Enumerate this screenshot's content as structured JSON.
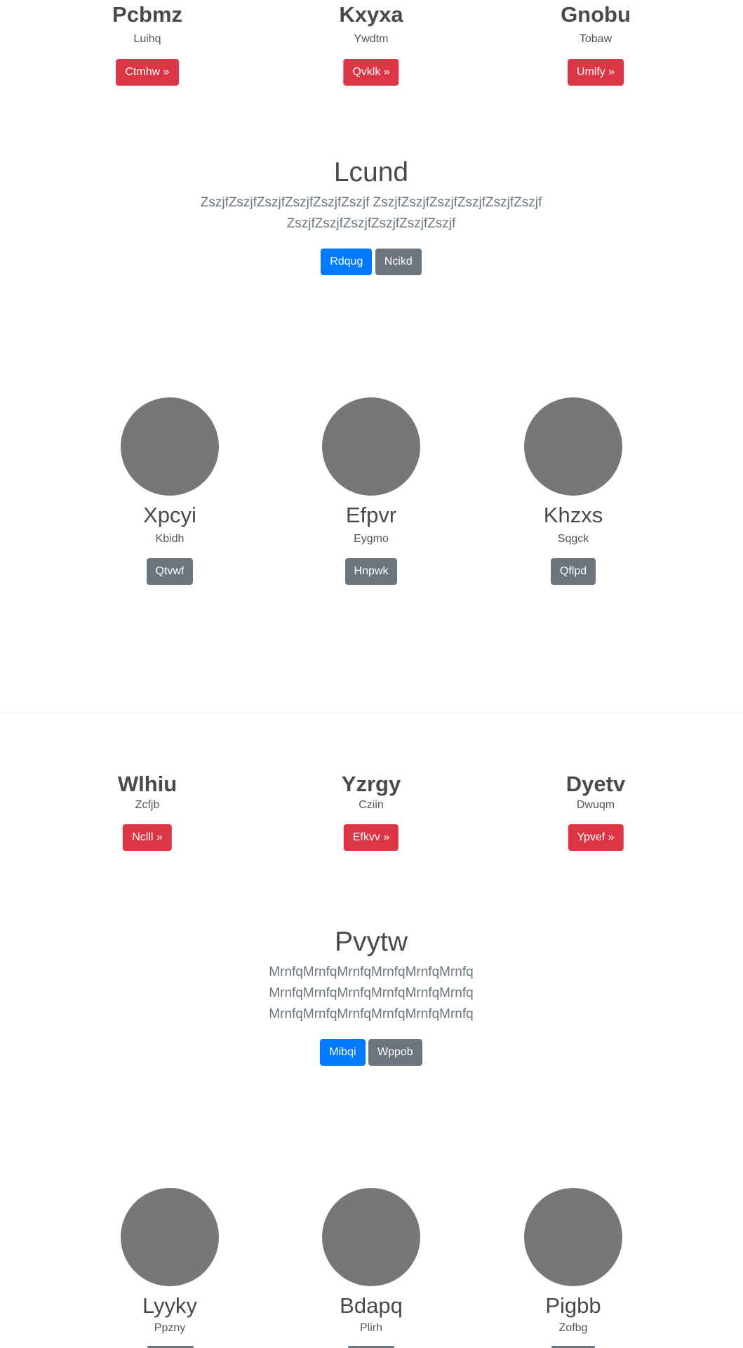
{
  "section1": {
    "columns": [
      {
        "title": "Pcbmz",
        "subtitle": "Luihq",
        "button": "Ctmhw »"
      },
      {
        "title": "Kxyxa",
        "subtitle": "Ywdtm",
        "button": "Qvklk »"
      },
      {
        "title": "Gnobu",
        "subtitle": "Tobaw",
        "button": "Umlfy »"
      }
    ]
  },
  "hero1": {
    "title": "Lcund",
    "lines": [
      "ZszjfZszjfZszjfZszjfZszjfZszjf ZszjfZszjfZszjfZszjfZszjfZszjf",
      "ZszjfZszjfZszjfZszjfZszjfZszjf"
    ],
    "primary": "Rdqug",
    "secondary": "Ncikd"
  },
  "team1": {
    "members": [
      {
        "name": "Xpcyi",
        "subtitle": "Kbidh",
        "button": "Qtvwf"
      },
      {
        "name": "Efpvr",
        "subtitle": "Eygmo",
        "button": "Hnpwk"
      },
      {
        "name": "Khzxs",
        "subtitle": "Sqgck",
        "button": "Qflpd"
      }
    ]
  },
  "section2": {
    "columns": [
      {
        "title": "Wlhiu",
        "subtitle": "Zcfjb",
        "button": "Nclll »"
      },
      {
        "title": "Yzrgy",
        "subtitle": "Cziin",
        "button": "Efkvv »"
      },
      {
        "title": "Dyetv",
        "subtitle": "Dwuqm",
        "button": "Ypvef »"
      }
    ]
  },
  "hero2": {
    "title": "Pvytw",
    "lines": [
      "MrnfqMrnfqMrnfqMrnfqMrnfqMrnfq",
      "MrnfqMrnfqMrnfqMrnfqMrnfqMrnfq",
      "MrnfqMrnfqMrnfqMrnfqMrnfqMrnfq"
    ],
    "primary": "Mibqi",
    "secondary": "Wppob"
  },
  "team2": {
    "members": [
      {
        "name": "Lyyky",
        "subtitle": "Ppzny"
      },
      {
        "name": "Bdapq",
        "subtitle": "Plirh"
      },
      {
        "name": "Pigbb",
        "subtitle": "Zofbg"
      }
    ]
  }
}
